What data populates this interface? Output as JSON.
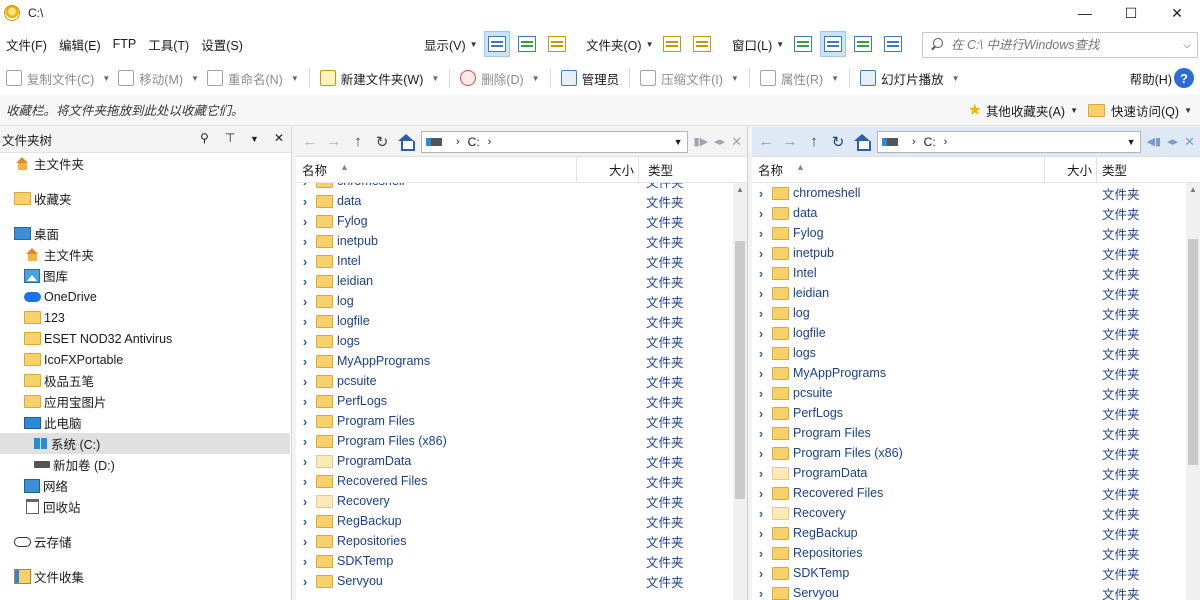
{
  "window": {
    "title": "C:\\",
    "minimize": "—",
    "maximize": "☐",
    "close": "✕"
  },
  "menu": [
    "文件(F)",
    "编辑(E)",
    "FTP",
    "工具(T)",
    "设置(S)"
  ],
  "view_menu": {
    "display": "显示(V)",
    "folder": "文件夹(O)",
    "window": "窗口(L)"
  },
  "search": {
    "placeholder": "在 C:\\ 中进行Windows查找",
    "value": ""
  },
  "toolbar": {
    "copy": "复制文件(C)",
    "move": "移动(M)",
    "rename": "重命名(N)",
    "new_folder": "新建文件夹(W)",
    "delete": "删除(D)",
    "admin": "管理员",
    "compress": "压缩文件(I)",
    "properties": "属性(R)",
    "slideshow": "幻灯片播放",
    "help": "帮助(H)",
    "help_icon": "?"
  },
  "favbar": {
    "hint": "收藏栏。将文件夹拖放到此处以收藏它们。",
    "other": "其他收藏夹(A)",
    "quick": "快速访问(Q)"
  },
  "tree": {
    "title": "文件夹树",
    "items": [
      {
        "label": "主文件夹",
        "icon": "home-icon"
      },
      {
        "label": "收藏夹",
        "icon": "folder-icon"
      },
      {
        "label": "桌面",
        "icon": "desktop-icon"
      },
      {
        "label": "主文件夹",
        "icon": "home-icon"
      },
      {
        "label": "图库",
        "icon": "gallery-icon"
      },
      {
        "label": "OneDrive",
        "icon": "onedrive-icon"
      },
      {
        "label": "123",
        "icon": "folder-icon"
      },
      {
        "label": "ESET NOD32 Antivirus",
        "icon": "folder-icon"
      },
      {
        "label": "IcoFXPortable",
        "icon": "folder-icon"
      },
      {
        "label": "极品五笔",
        "icon": "folder-icon"
      },
      {
        "label": "应用宝图片",
        "icon": "folder-icon"
      },
      {
        "label": "此电脑",
        "icon": "computer-icon"
      },
      {
        "label": "系统 (C:)",
        "icon": "system-drive-icon"
      },
      {
        "label": "新加卷 (D:)",
        "icon": "drive-icon"
      },
      {
        "label": "网络",
        "icon": "network-icon"
      },
      {
        "label": "回收站",
        "icon": "recycle-bin-icon"
      },
      {
        "label": "云存储",
        "icon": "cloud-icon"
      },
      {
        "label": "文件收集",
        "icon": "collection-icon"
      }
    ]
  },
  "left_pane": {
    "address": "C:",
    "columns": {
      "name": "名称",
      "size": "大小",
      "type": "类型"
    },
    "files": [
      {
        "name": "chromeshell",
        "type": "文件夹"
      },
      {
        "name": "data",
        "type": "文件夹"
      },
      {
        "name": "Fylog",
        "type": "文件夹"
      },
      {
        "name": "inetpub",
        "type": "文件夹"
      },
      {
        "name": "Intel",
        "type": "文件夹"
      },
      {
        "name": "leidian",
        "type": "文件夹"
      },
      {
        "name": "log",
        "type": "文件夹"
      },
      {
        "name": "logfile",
        "type": "文件夹"
      },
      {
        "name": "logs",
        "type": "文件夹"
      },
      {
        "name": "MyAppPrograms",
        "type": "文件夹"
      },
      {
        "name": "pcsuite",
        "type": "文件夹"
      },
      {
        "name": "PerfLogs",
        "type": "文件夹"
      },
      {
        "name": "Program Files",
        "type": "文件夹"
      },
      {
        "name": "Program Files (x86)",
        "type": "文件夹"
      },
      {
        "name": "ProgramData",
        "type": "文件夹"
      },
      {
        "name": "Recovered Files",
        "type": "文件夹"
      },
      {
        "name": "Recovery",
        "type": "文件夹"
      },
      {
        "name": "RegBackup",
        "type": "文件夹"
      },
      {
        "name": "Repositories",
        "type": "文件夹"
      },
      {
        "name": "SDKTemp",
        "type": "文件夹"
      },
      {
        "name": "Servyou",
        "type": "文件夹"
      }
    ]
  },
  "right_pane": {
    "address": "C:",
    "columns": {
      "name": "名称",
      "size": "大小",
      "type": "类型"
    },
    "files": [
      {
        "name": "chromeshell",
        "type": "文件夹"
      },
      {
        "name": "data",
        "type": "文件夹"
      },
      {
        "name": "Fylog",
        "type": "文件夹"
      },
      {
        "name": "inetpub",
        "type": "文件夹"
      },
      {
        "name": "Intel",
        "type": "文件夹"
      },
      {
        "name": "leidian",
        "type": "文件夹"
      },
      {
        "name": "log",
        "type": "文件夹"
      },
      {
        "name": "logfile",
        "type": "文件夹"
      },
      {
        "name": "logs",
        "type": "文件夹"
      },
      {
        "name": "MyAppPrograms",
        "type": "文件夹"
      },
      {
        "name": "pcsuite",
        "type": "文件夹"
      },
      {
        "name": "PerfLogs",
        "type": "文件夹"
      },
      {
        "name": "Program Files",
        "type": "文件夹"
      },
      {
        "name": "Program Files (x86)",
        "type": "文件夹"
      },
      {
        "name": "ProgramData",
        "type": "文件夹"
      },
      {
        "name": "Recovered Files",
        "type": "文件夹"
      },
      {
        "name": "Recovery",
        "type": "文件夹"
      },
      {
        "name": "RegBackup",
        "type": "文件夹"
      },
      {
        "name": "Repositories",
        "type": "文件夹"
      },
      {
        "name": "SDKTemp",
        "type": "文件夹"
      },
      {
        "name": "Servyou",
        "type": "文件夹"
      }
    ]
  },
  "colors": {
    "accent": "#2d5fa8",
    "folder": "#f7d26b",
    "selected_view": "#cce4f7",
    "active_pane_nav": "#dfe9f6"
  }
}
